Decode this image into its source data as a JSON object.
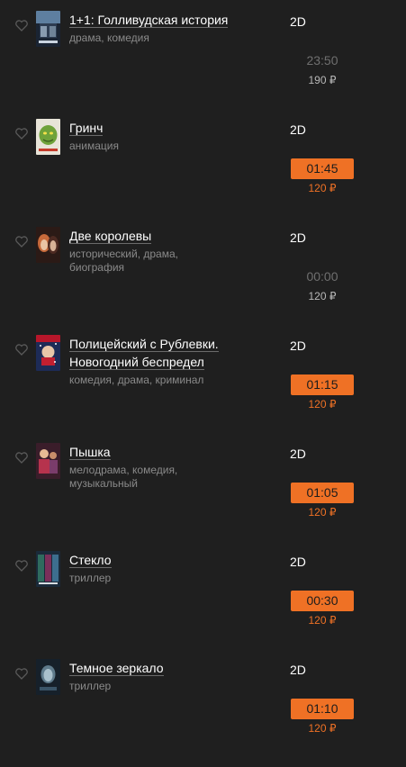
{
  "sessions": [
    {
      "title": "1+1: Голливудская история",
      "genres": [
        "драма, комедия"
      ],
      "format": "2D",
      "time": "23:50",
      "price": "190 ₽",
      "state": "past",
      "poster": "poster-1plus1"
    },
    {
      "title": "Гринч",
      "genres": [
        "анимация"
      ],
      "format": "2D",
      "time": "01:45",
      "price": "120 ₽",
      "state": "active",
      "poster": "poster-grinch"
    },
    {
      "title": "Две королевы",
      "genres": [
        "исторический, драма,",
        "биография"
      ],
      "format": "2D",
      "time": "00:00",
      "price": "120 ₽",
      "state": "past",
      "poster": "poster-two-queens"
    },
    {
      "title": "Полицейский с Рублевки. Новогодний беспредел",
      "genres": [
        "комедия, драма, криминал"
      ],
      "format": "2D",
      "time": "01:15",
      "price": "120 ₽",
      "state": "active",
      "poster": "poster-rublevka"
    },
    {
      "title": "Пышка",
      "genres": [
        "мелодрама, комедия,",
        "музыкальный"
      ],
      "format": "2D",
      "time": "01:05",
      "price": "120 ₽",
      "state": "active",
      "poster": "poster-pyshka"
    },
    {
      "title": "Стекло",
      "genres": [
        "триллер"
      ],
      "format": "2D",
      "time": "00:30",
      "price": "120 ₽",
      "state": "active",
      "poster": "poster-glass"
    },
    {
      "title": "Темное зеркало",
      "genres": [
        "триллер"
      ],
      "format": "2D",
      "time": "01:10",
      "price": "120 ₽",
      "state": "active",
      "poster": "poster-dark-mirror"
    }
  ],
  "colors": {
    "accent": "#ef7125",
    "background": "#1f1f1f",
    "muted": "#8a8a8a"
  },
  "icons": {
    "favorite": "heart-outline-icon"
  }
}
